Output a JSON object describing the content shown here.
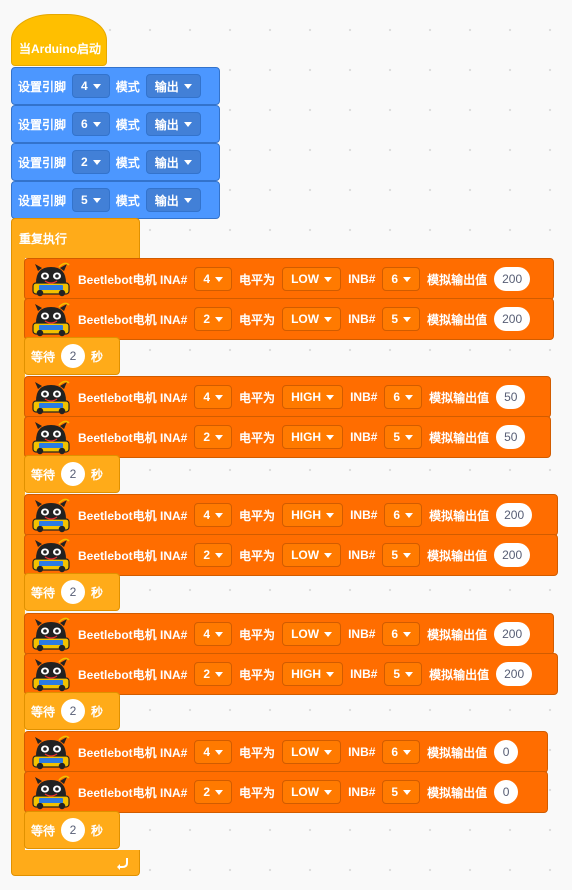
{
  "hat": {
    "label": "当Arduino启动"
  },
  "pin_blocks": [
    {
      "prefix": "设置引脚",
      "pin": "4",
      "mode_label": "模式",
      "mode": "输出"
    },
    {
      "prefix": "设置引脚",
      "pin": "6",
      "mode_label": "模式",
      "mode": "输出"
    },
    {
      "prefix": "设置引脚",
      "pin": "2",
      "mode_label": "模式",
      "mode": "输出"
    },
    {
      "prefix": "设置引脚",
      "pin": "5",
      "mode_label": "模式",
      "mode": "输出"
    }
  ],
  "loop": {
    "label": "重复执行"
  },
  "wait": {
    "label": "等待",
    "unit": "秒",
    "value": "2"
  },
  "motor_labels": {
    "title": "Beetlebot电机 INA#",
    "level": "电平为",
    "inb": "INB#",
    "analog": "模拟输出值"
  },
  "sequence": [
    {
      "type": "motor",
      "ina": "4",
      "level": "LOW",
      "inb": "6",
      "value": "200"
    },
    {
      "type": "motor",
      "ina": "2",
      "level": "LOW",
      "inb": "5",
      "value": "200"
    },
    {
      "type": "wait",
      "value": "2"
    },
    {
      "type": "motor",
      "ina": "4",
      "level": "HIGH",
      "inb": "6",
      "value": "50"
    },
    {
      "type": "motor",
      "ina": "2",
      "level": "HIGH",
      "inb": "5",
      "value": "50"
    },
    {
      "type": "wait",
      "value": "2"
    },
    {
      "type": "motor",
      "ina": "4",
      "level": "HIGH",
      "inb": "6",
      "value": "200"
    },
    {
      "type": "motor",
      "ina": "2",
      "level": "LOW",
      "inb": "5",
      "value": "200"
    },
    {
      "type": "wait",
      "value": "2"
    },
    {
      "type": "motor",
      "ina": "4",
      "level": "LOW",
      "inb": "6",
      "value": "200"
    },
    {
      "type": "motor",
      "ina": "2",
      "level": "HIGH",
      "inb": "5",
      "value": "200"
    },
    {
      "type": "wait",
      "value": "2"
    },
    {
      "type": "motor",
      "ina": "4",
      "level": "LOW",
      "inb": "6",
      "value": "0"
    },
    {
      "type": "motor",
      "ina": "2",
      "level": "LOW",
      "inb": "5",
      "value": "0"
    },
    {
      "type": "wait",
      "value": "2"
    }
  ],
  "icons": {
    "robot": "beetlebot-robot-icon",
    "loop_arrow": "loop-arrow-icon",
    "dropdown": "dropdown-caret-icon"
  },
  "colors": {
    "event": "#ffbf00",
    "control": "#ffab19",
    "pin": "#4c97ff",
    "motor": "#ff6d00"
  }
}
